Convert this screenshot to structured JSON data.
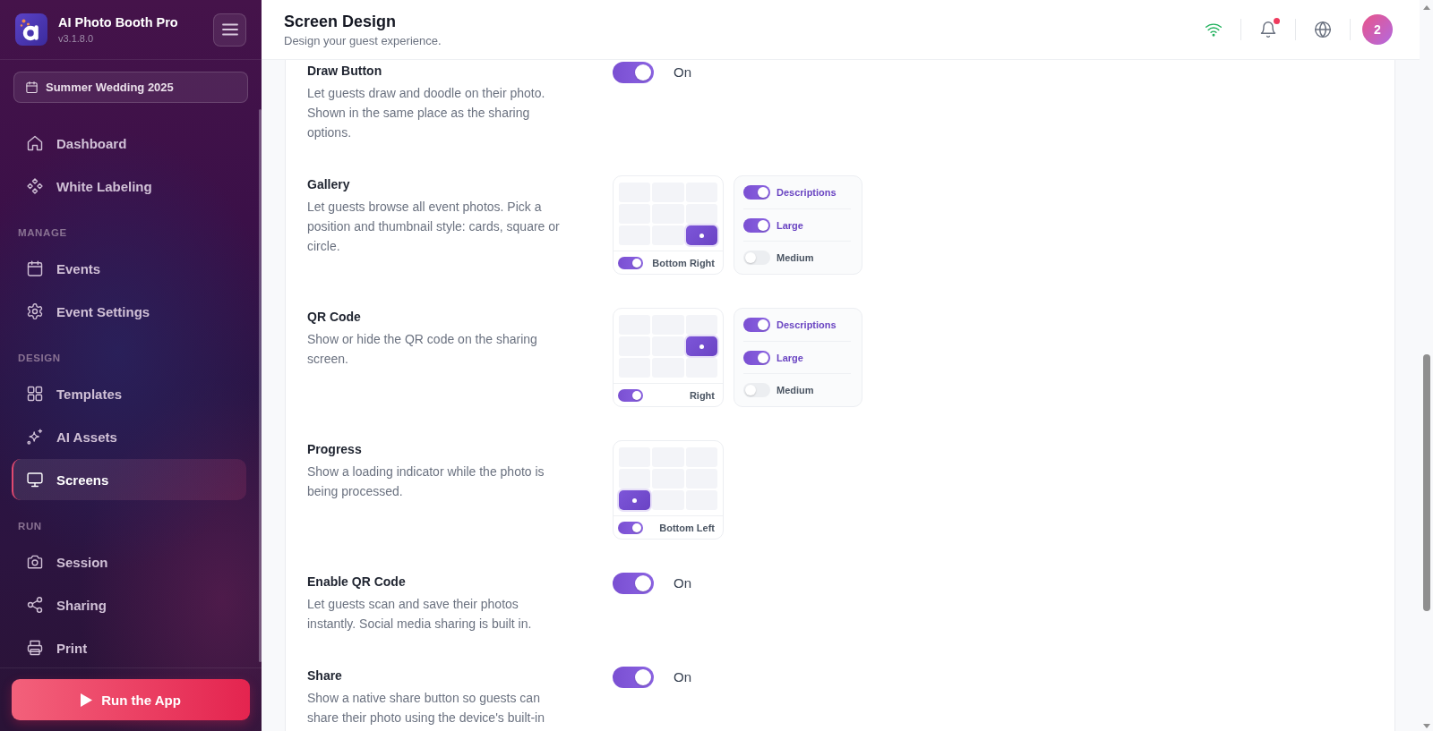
{
  "sidebar": {
    "app_name": "AI Photo Booth Pro",
    "version": "v3.1.8.0",
    "event": "Summer Wedding 2025",
    "sections": [
      {
        "items": [
          {
            "label": "Dashboard",
            "selected": false
          },
          {
            "label": "White Labeling",
            "selected": false
          }
        ]
      },
      {
        "title": "MANAGE",
        "items": [
          {
            "label": "Events",
            "selected": false
          },
          {
            "label": "Event Settings",
            "selected": false
          }
        ]
      },
      {
        "title": "DESIGN",
        "items": [
          {
            "label": "Templates",
            "selected": false
          },
          {
            "label": "AI Assets",
            "selected": false
          },
          {
            "label": "Screens",
            "selected": true
          }
        ]
      },
      {
        "title": "RUN",
        "items": [
          {
            "label": "Session",
            "selected": false
          },
          {
            "label": "Sharing",
            "selected": false
          },
          {
            "label": "Print",
            "selected": false
          }
        ]
      }
    ],
    "run_button": "Run the App"
  },
  "header": {
    "title": "Screen Design",
    "subtitle": "Design your guest experience.",
    "connected": true,
    "unread_notifications": true,
    "avatar": "2"
  },
  "settings": [
    {
      "kind": "switch",
      "title": "Draw Button",
      "description": "Let guests draw and doodle on their photo. Shown in the same place as the sharing options.",
      "on": true,
      "state_label": "On"
    },
    {
      "kind": "placement",
      "title": "Gallery",
      "description": "Let guests browse all event photos. Pick a position and thumbnail style: cards, square or circle.",
      "position_cells": [
        {
          "selected": false
        },
        {
          "selected": false
        },
        {
          "selected": false
        },
        {
          "selected": false
        },
        {
          "selected": false
        },
        {
          "selected": false
        },
        {
          "selected": false
        },
        {
          "selected": false
        },
        {
          "selected": true
        }
      ],
      "enabled": true,
      "position_label": "Bottom Right",
      "options": [
        {
          "label": "Descriptions",
          "on": true
        },
        {
          "label": "Large",
          "on": true
        },
        {
          "label": "Medium",
          "on": false
        }
      ]
    },
    {
      "kind": "placement",
      "title": "QR Code",
      "description": "Show or hide the QR code on the sharing screen.",
      "position_cells": [
        {
          "selected": false
        },
        {
          "selected": false
        },
        {
          "selected": false
        },
        {
          "selected": false
        },
        {
          "selected": false
        },
        {
          "selected": true
        },
        {
          "selected": false
        },
        {
          "selected": false
        },
        {
          "selected": false
        }
      ],
      "enabled": true,
      "position_label": "Right",
      "options": [
        {
          "label": "Descriptions",
          "on": true
        },
        {
          "label": "Large",
          "on": true
        },
        {
          "label": "Medium",
          "on": false
        }
      ]
    },
    {
      "kind": "placement",
      "title": "Progress",
      "description": "Show a loading indicator while the photo is being processed.",
      "position_cells": [
        {
          "selected": false
        },
        {
          "selected": false
        },
        {
          "selected": false
        },
        {
          "selected": false
        },
        {
          "selected": false
        },
        {
          "selected": false
        },
        {
          "selected": true
        },
        {
          "selected": false
        },
        {
          "selected": false
        }
      ],
      "enabled": true,
      "position_label": "Bottom Left"
    },
    {
      "kind": "switch",
      "title": "Enable QR Code",
      "description": "Let guests scan and save their photos instantly. Social media sharing is built in.",
      "on": true,
      "state_label": "On"
    },
    {
      "kind": "switch",
      "title": "Share",
      "description": "Show a native share button so guests can share their photo using the device's built-in",
      "on": true,
      "state_label": "On"
    }
  ]
}
